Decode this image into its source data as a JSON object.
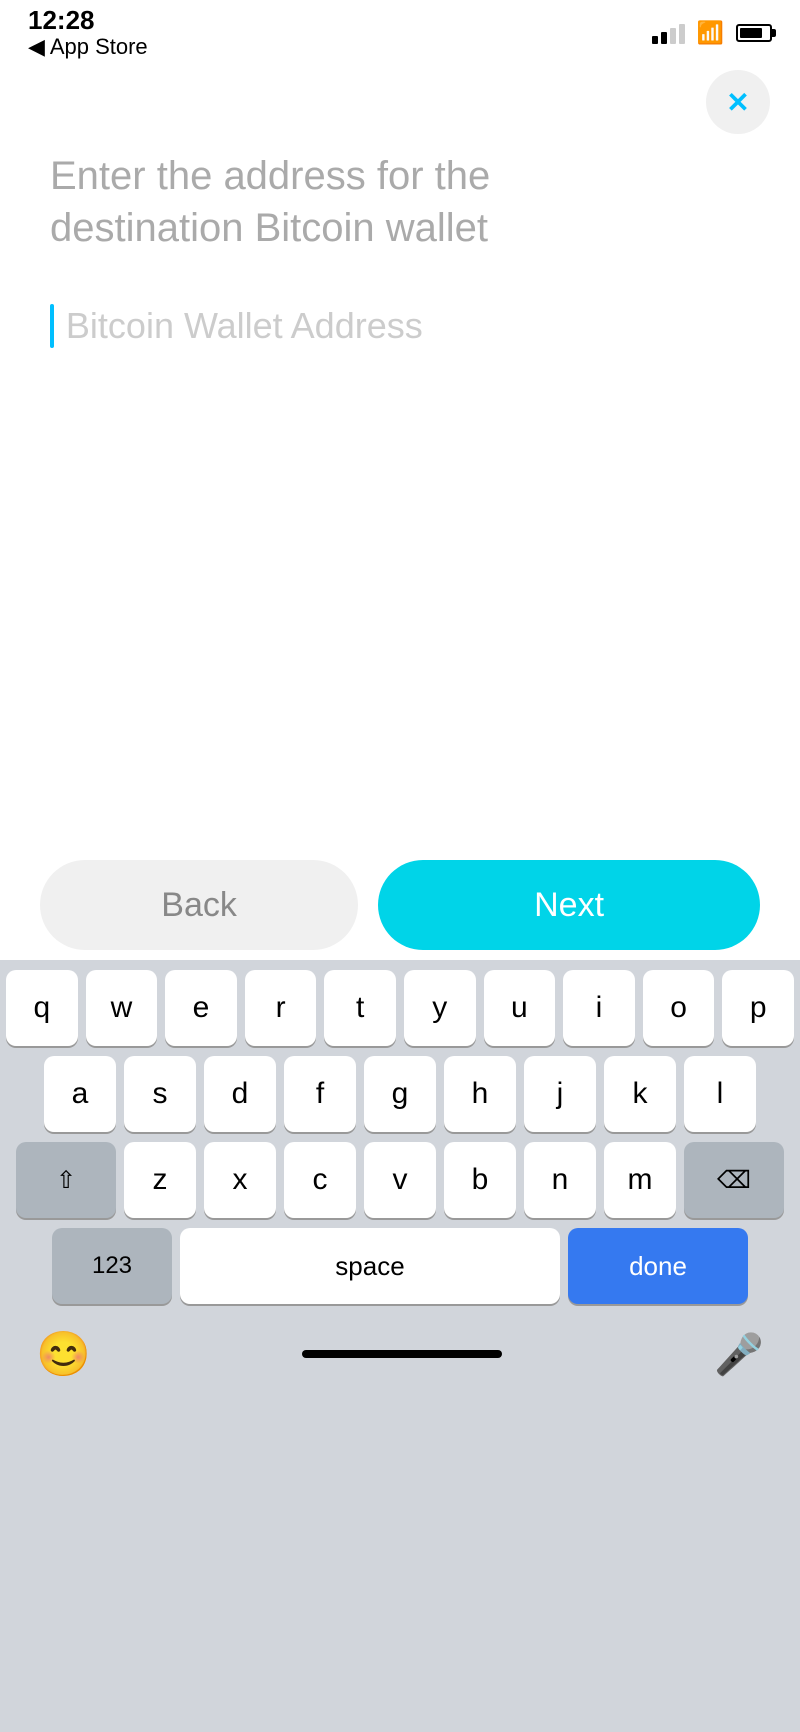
{
  "statusBar": {
    "time": "12:28",
    "navigation": "◀ App Store"
  },
  "header": {
    "closeLabel": "✕"
  },
  "content": {
    "heading": "Enter the address for the destination Bitcoin wallet",
    "inputPlaceholder": "Bitcoin Wallet Address"
  },
  "buttons": {
    "back": "Back",
    "next": "Next"
  },
  "keyboard": {
    "rows": [
      [
        "q",
        "w",
        "e",
        "r",
        "t",
        "y",
        "u",
        "i",
        "o",
        "p"
      ],
      [
        "a",
        "s",
        "d",
        "f",
        "g",
        "h",
        "j",
        "k",
        "l"
      ],
      [
        "z",
        "x",
        "c",
        "v",
        "b",
        "n",
        "m"
      ]
    ],
    "bottomRow": {
      "numbers": "123",
      "space": "space",
      "done": "done"
    },
    "bottomBar": {
      "emoji": "😊",
      "mic": "🎤"
    }
  },
  "colors": {
    "accent": "#00D4E8",
    "closeIcon": "#00BFFF",
    "doneKey": "#3579f0"
  }
}
